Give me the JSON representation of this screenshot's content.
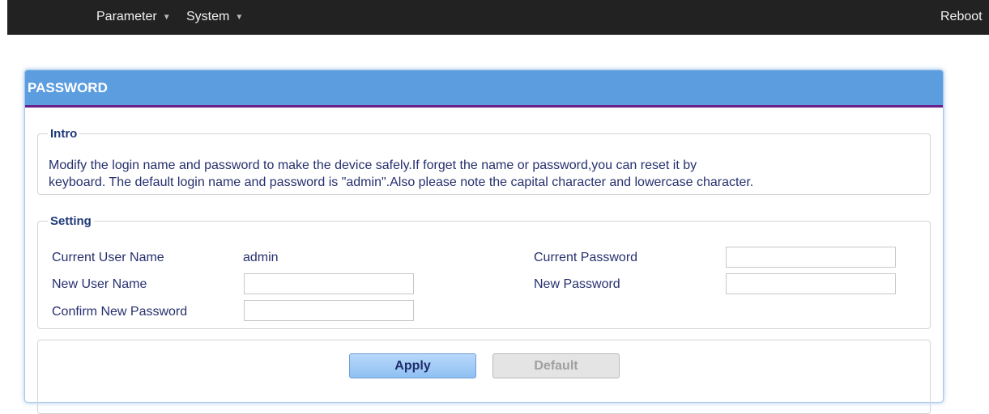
{
  "nav": {
    "parameter": "Parameter",
    "system": "System",
    "reboot": "Reboot"
  },
  "panel": {
    "title": "PASSWORD",
    "intro": {
      "legend": "Intro",
      "line1": "Modify the login name and password to make the device safely.If forget the name or password,you can reset it by",
      "line2": "keyboard. The default login name and password is \"admin\".Also please note the capital character and lowercase character."
    },
    "setting": {
      "legend": "Setting",
      "current_user_name_label": "Current User Name",
      "current_user_name_value": "admin",
      "new_user_name_label": "New User Name",
      "new_user_name_value": "",
      "confirm_new_password_label": "Confirm New Password",
      "confirm_new_password_value": "",
      "current_password_label": "Current Password",
      "current_password_value": "",
      "new_password_label": "New Password",
      "new_password_value": ""
    },
    "buttons": {
      "apply": "Apply",
      "default": "Default"
    }
  }
}
